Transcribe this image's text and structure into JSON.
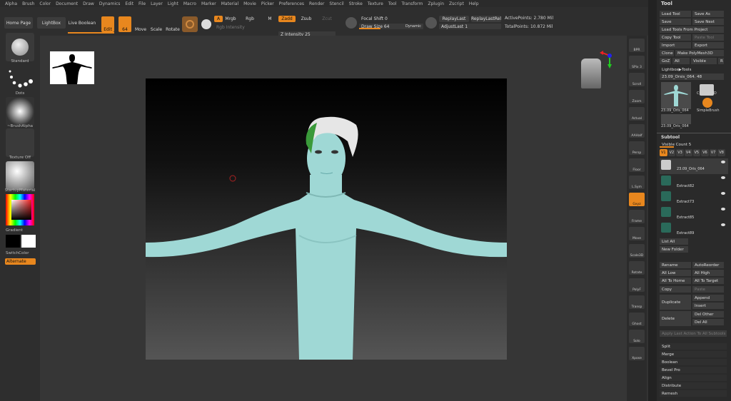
{
  "menu": [
    "Alpha",
    "Brush",
    "Color",
    "Document",
    "Draw",
    "Dynamics",
    "Edit",
    "File",
    "Layer",
    "Light",
    "Macro",
    "Marker",
    "Material",
    "Movie",
    "Picker",
    "Preferences",
    "Render",
    "Stencil",
    "Stroke",
    "Texture",
    "Tool",
    "Transform",
    "Zplugin",
    "Zscript",
    "Help"
  ],
  "top": {
    "home": "Home Page",
    "lightbox": "LightBox",
    "liveboolean": "Live Boolean",
    "edit": "Edit",
    "draw": "64",
    "move": "Move",
    "scale": "Scale",
    "rotate": "Rotate",
    "a": "A",
    "mrgb": "Mrgb",
    "rgb": "Rgb",
    "m": "M",
    "zadd": "Zadd",
    "zsub": "Zsub",
    "zcut": "Zcut",
    "rgb_int": "Rgb Intensity",
    "z_int_label": "Z Intensity",
    "z_int": "25",
    "focal_label": "Focal Shift",
    "focal": "0",
    "draw_label": "Draw Size",
    "dynamic": "Dynamic",
    "replay": "ReplayLast",
    "replayrel": "ReplayLastRel",
    "adjust_label": "AdjustLast",
    "adjust": "1",
    "active": "ActivePoints: 2.780 Mil",
    "total": "TotalPoints: 10.872 Mil"
  },
  "left": {
    "standard": "Standard",
    "dots": "Dots",
    "brushalpha": "~BrushAlpha",
    "texture": "Texture Off",
    "material": "StartupMaterial",
    "gradient": "Gradient",
    "switch": "SwitchColor",
    "alternate": "Alternate"
  },
  "right": [
    "BPR",
    "SPix 3",
    "Scroll",
    "Zoom",
    "Actual",
    "AAHalf",
    "Persp",
    "Floor",
    "L.Sym",
    "Gxyz",
    "Frame",
    "Move",
    "Scale3D",
    "Rotate",
    "PolyF",
    "Transp",
    "Ghost",
    "Solo",
    "Xpose"
  ],
  "tool": {
    "title": "Tool",
    "load": "Load Tool",
    "saveas": "Save As",
    "save": "Save",
    "savenext": "Save Next",
    "loadproj": "Load Tools From Project",
    "copy": "Copy Tool",
    "paste": "Paste Tool",
    "import": "Import",
    "export": "Export",
    "clone": "Clone",
    "makepm": "Make PolyMesh3D",
    "goz": "GoZ",
    "all": "All",
    "visible": "Visible",
    "r": "R",
    "lbtools": "Lightbox▶Tools",
    "current": "23.09_Orsis_064. 48",
    "t1": "23.09_Oris_064",
    "t2": "Cylinder3D",
    "t3": "SimpleBrush",
    "t4": "23.09_Oris_064",
    "subtool": "Subtool",
    "viscount": "Visible Count 5",
    "versions": [
      "V1",
      "V2",
      "V3",
      "V4",
      "V5",
      "V6",
      "V7",
      "V8"
    ],
    "subtools": [
      "23.09_Oris_064",
      "Extract82",
      "Extract73",
      "Extract85",
      "Extract89"
    ],
    "listall": "List All",
    "newfolder": "New Folder",
    "rename": "Rename",
    "autoreorder": "AutoReorder",
    "alllow": "All Low",
    "allhigh": "All High",
    "alltohome": "All To Home",
    "alltotarget": "All To Target",
    "copyb": "Copy",
    "pasteb": "Paste",
    "duplicate": "Duplicate",
    "append": "Append",
    "insert": "Insert",
    "delete": "Delete",
    "delother": "Del Other",
    "delall": "Del All",
    "applylast": "Apply Last Action To All Subtools",
    "split": "Split",
    "merge": "Merge",
    "boolean": "Boolean",
    "bevel": "Bevel Pro",
    "align": "Align",
    "distribute": "Distribute",
    "remesh": "Remesh"
  }
}
